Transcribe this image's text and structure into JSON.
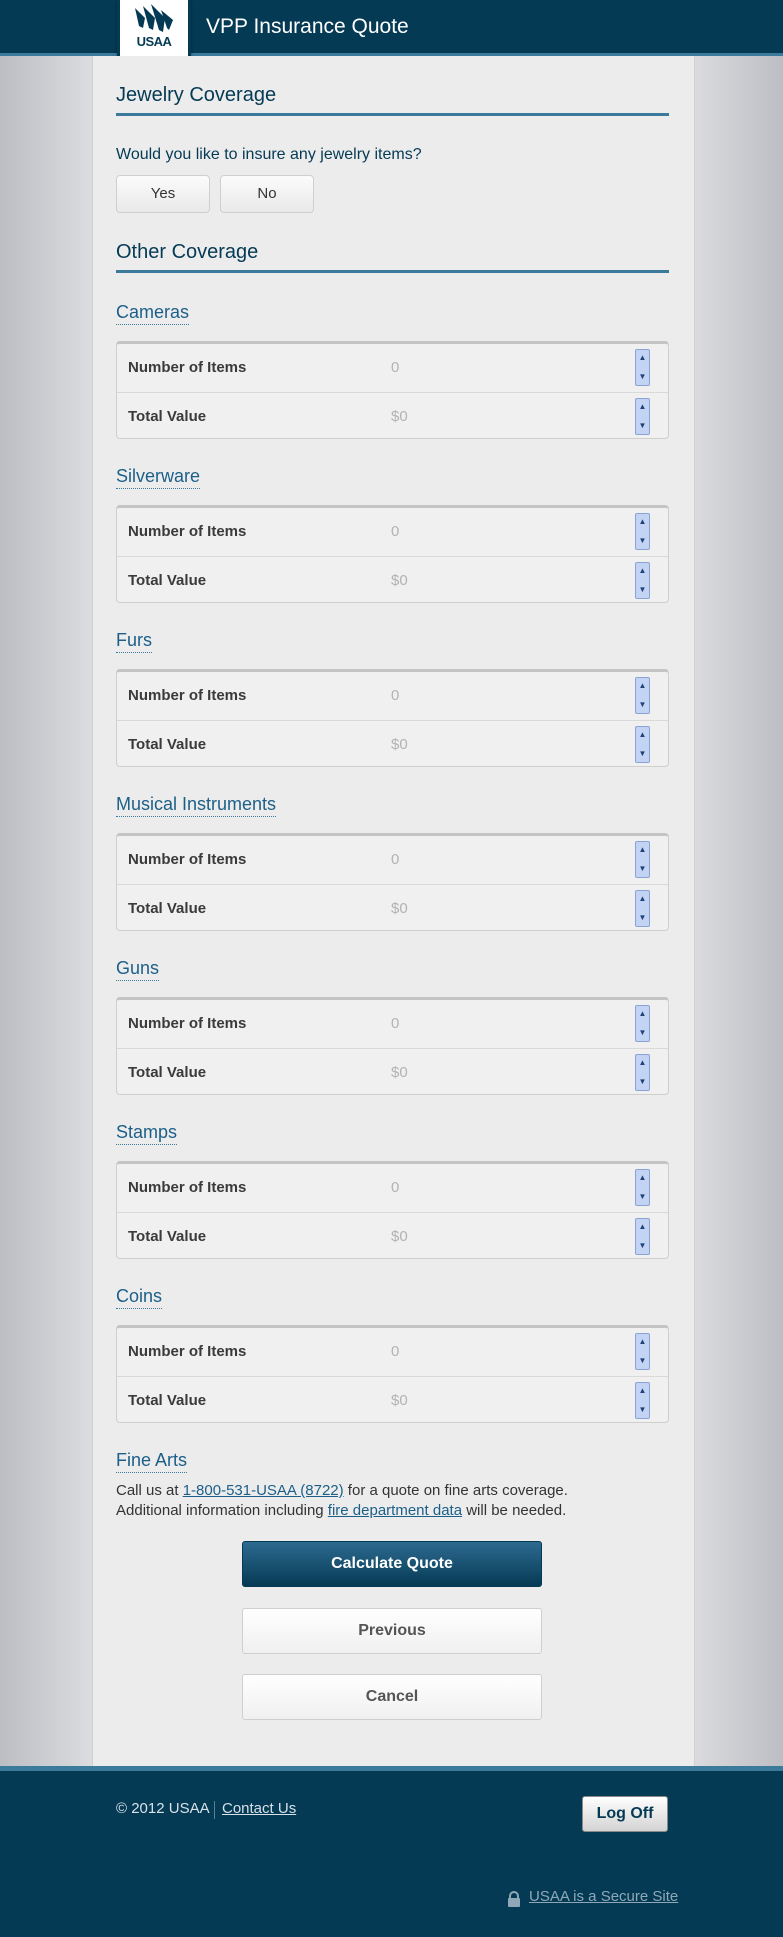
{
  "header": {
    "logo_text": "USAA",
    "title": "VPP Insurance Quote"
  },
  "jewelry": {
    "title": "Jewelry Coverage",
    "question": "Would you like to insure any jewelry items?",
    "yes_label": "Yes",
    "no_label": "No"
  },
  "other": {
    "title": "Other Coverage",
    "row_labels": {
      "items": "Number of Items",
      "value": "Total Value"
    },
    "categories": [
      {
        "name": "Cameras",
        "items": "0",
        "value": "$0"
      },
      {
        "name": "Silverware",
        "items": "0",
        "value": "$0"
      },
      {
        "name": "Furs",
        "items": "0",
        "value": "$0"
      },
      {
        "name": "Musical Instruments",
        "items": "0",
        "value": "$0"
      },
      {
        "name": "Guns",
        "items": "0",
        "value": "$0"
      },
      {
        "name": "Stamps",
        "items": "0",
        "value": "$0"
      },
      {
        "name": "Coins",
        "items": "0",
        "value": "$0"
      }
    ]
  },
  "fine_arts": {
    "title": "Fine Arts",
    "line1_prefix": "Call us at ",
    "phone": "1-800-531-USAA (8722)",
    "line1_suffix": " for a quote on fine arts coverage.",
    "line2_prefix": "Additional information including ",
    "fire_link": "fire department data",
    "line2_suffix": " will be needed."
  },
  "actions": {
    "calculate": "Calculate Quote",
    "previous": "Previous",
    "cancel": "Cancel"
  },
  "footer": {
    "copyright": "© 2012 USAA",
    "contact": "Contact Us",
    "logoff": "Log Off",
    "secure": "USAA is a Secure Site"
  },
  "icons": {
    "logo": "usaa-eagle-icon",
    "spinner_up": "chevron-up-icon",
    "spinner_down": "chevron-down-icon",
    "lock": "lock-icon"
  },
  "colors": {
    "brand": "#053a54",
    "accent": "#3b7a9a",
    "link": "#1c5f89"
  }
}
